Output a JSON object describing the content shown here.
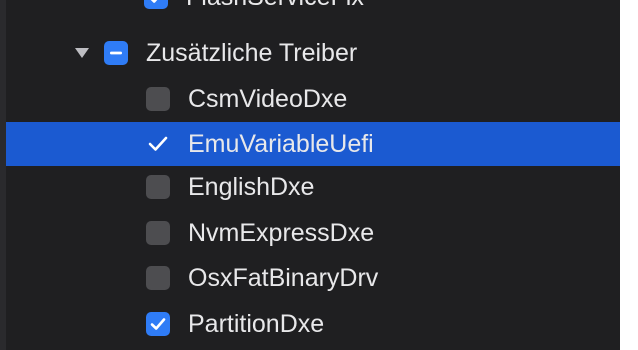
{
  "tree": {
    "rows": [
      {
        "label": "FlashServiceFix",
        "state": "checked"
      },
      {
        "label": "Zusätzliche Treiber",
        "state": "mixed",
        "expanded": true
      },
      {
        "label": "CsmVideoDxe",
        "state": "unchecked"
      },
      {
        "label": "EmuVariableUefi",
        "state": "checked",
        "selected": true
      },
      {
        "label": "EnglishDxe",
        "state": "unchecked"
      },
      {
        "label": "NvmExpressDxe",
        "state": "unchecked"
      },
      {
        "label": "OsxFatBinaryDrv",
        "state": "unchecked"
      },
      {
        "label": "PartitionDxe",
        "state": "checked"
      }
    ]
  },
  "colors": {
    "background": "#1f1f21",
    "selection": "#1b5ad1",
    "checkbox_checked": "#2f7cf6",
    "checkbox_unchecked": "#4d4d50",
    "text": "#e8e8ea"
  }
}
